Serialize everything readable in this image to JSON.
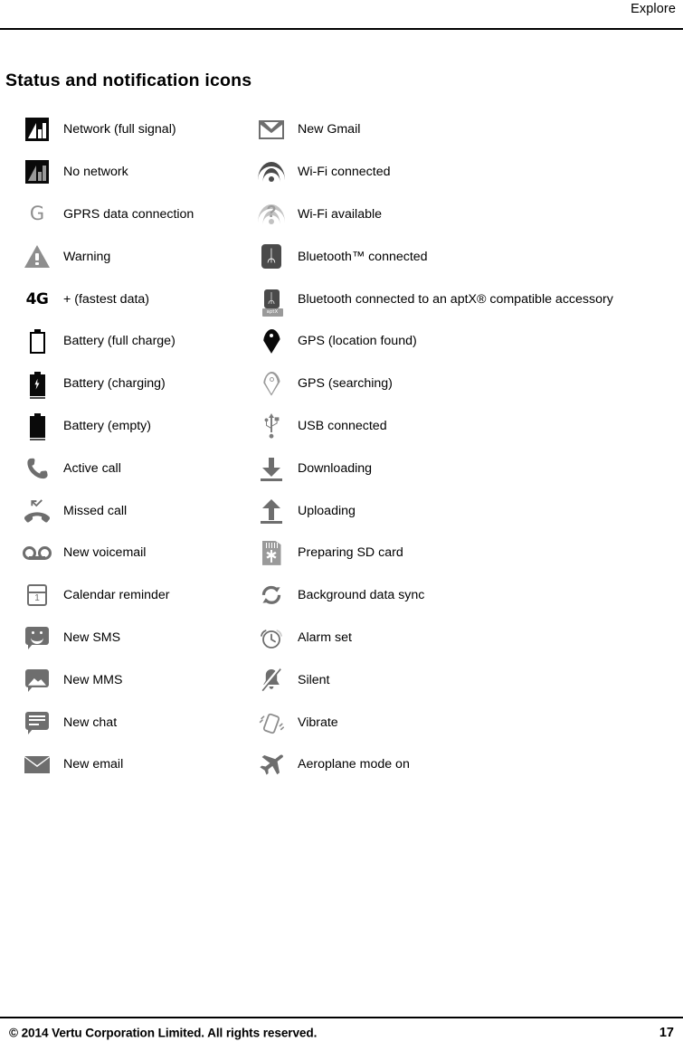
{
  "header": {
    "title": "Explore"
  },
  "page_title": "Status and notification icons",
  "footer": {
    "copyright": "© 2014 Vertu Corporation Limited. All rights reserved.",
    "page_number": "17"
  },
  "colors": {
    "text": "#000000",
    "icon_gray": "#6e6e6e",
    "icon_light_gray": "#9a9a9a",
    "icon_black": "#0a0a0a",
    "rule": "#000000"
  },
  "left_column": [
    {
      "icon": "network-full-signal-icon",
      "label": "Network (full signal)"
    },
    {
      "icon": "no-network-icon",
      "label": "No network"
    },
    {
      "icon": "gprs-data-icon",
      "label": "GPRS data connection"
    },
    {
      "icon": "warning-icon",
      "label": "Warning"
    },
    {
      "icon": "4g-data-icon",
      "label": "+ (fastest data)"
    },
    {
      "icon": "battery-full-icon",
      "label": "Battery (full charge)"
    },
    {
      "icon": "battery-charging-icon",
      "label": "Battery (charging)"
    },
    {
      "icon": "battery-empty-icon",
      "label": "Battery (empty)"
    },
    {
      "icon": "active-call-icon",
      "label": "Active call"
    },
    {
      "icon": "missed-call-icon",
      "label": "Missed call"
    },
    {
      "icon": "voicemail-icon",
      "label": "New voicemail"
    },
    {
      "icon": "calendar-reminder-icon",
      "label": "Calendar reminder"
    },
    {
      "icon": "new-sms-icon",
      "label": "New SMS"
    },
    {
      "icon": "new-mms-icon",
      "label": "New MMS"
    },
    {
      "icon": "new-chat-icon",
      "label": "New chat"
    },
    {
      "icon": "new-email-icon",
      "label": "New email"
    }
  ],
  "right_column": [
    {
      "icon": "gmail-icon",
      "label": "New Gmail"
    },
    {
      "icon": "wifi-connected-icon",
      "label": "Wi-Fi connected"
    },
    {
      "icon": "wifi-available-icon",
      "label": "Wi-Fi available"
    },
    {
      "icon": "bluetooth-icon",
      "label": "Bluetooth™ connected"
    },
    {
      "icon": "bluetooth-aptx-icon",
      "label": "Bluetooth connected to an aptX® compatible accessory",
      "badge": "aptX"
    },
    {
      "icon": "gps-found-icon",
      "label": "GPS (location found)"
    },
    {
      "icon": "gps-searching-icon",
      "label": "GPS (searching)"
    },
    {
      "icon": "usb-connected-icon",
      "label": "USB connected"
    },
    {
      "icon": "download-icon",
      "label": "Downloading"
    },
    {
      "icon": "upload-icon",
      "label": "Uploading"
    },
    {
      "icon": "sd-card-icon",
      "label": "Preparing SD card"
    },
    {
      "icon": "sync-icon",
      "label": "Background data sync"
    },
    {
      "icon": "alarm-icon",
      "label": "Alarm set"
    },
    {
      "icon": "silent-icon",
      "label": "Silent"
    },
    {
      "icon": "vibrate-icon",
      "label": "Vibrate"
    },
    {
      "icon": "aeroplane-mode-icon",
      "label": "Aeroplane mode on"
    }
  ],
  "misc": {
    "gprs_glyph": "G",
    "fourg_glyph": "4G",
    "calendar_day": "1",
    "bluetooth_glyph": "ᛦ",
    "wifi_question": "?"
  }
}
